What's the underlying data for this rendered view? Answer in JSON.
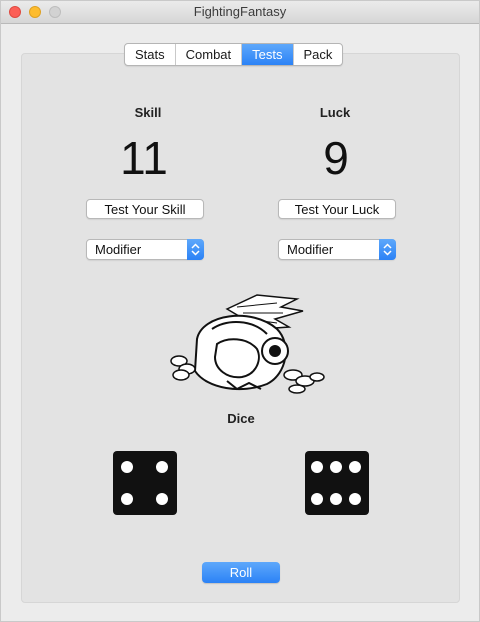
{
  "window": {
    "title": "FightingFantasy"
  },
  "tabs": [
    {
      "label": "Stats",
      "active": false
    },
    {
      "label": "Combat",
      "active": false
    },
    {
      "label": "Tests",
      "active": true
    },
    {
      "label": "Pack",
      "active": false
    }
  ],
  "skill": {
    "label": "Skill",
    "value": "11",
    "test_button": "Test Your Skill",
    "modifier": "Modifier"
  },
  "luck": {
    "label": "Luck",
    "value": "9",
    "test_button": "Test Your Luck",
    "modifier": "Modifier"
  },
  "dice": {
    "label": "Dice",
    "left_value": 4,
    "right_value": 6
  },
  "roll_button": "Roll",
  "colors": {
    "accent": "#2b82f6",
    "close": "#fc5f57",
    "minimize": "#fdbc2e"
  },
  "illustration": {
    "icon": "treasure-hoard-illustration"
  }
}
